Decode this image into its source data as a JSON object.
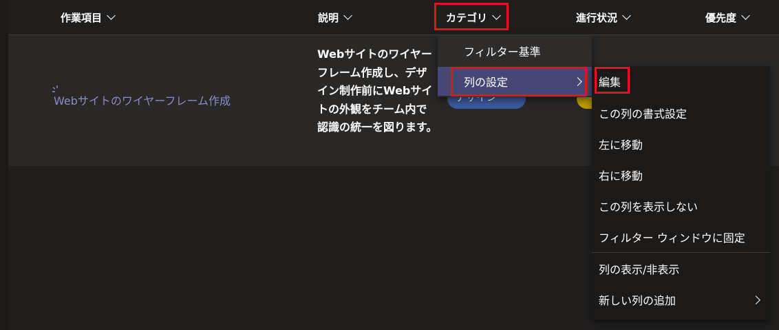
{
  "header": {
    "columns": [
      {
        "label": "作業項目"
      },
      {
        "label": "説明"
      },
      {
        "label": "カテゴリ"
      },
      {
        "label": "進行状況"
      },
      {
        "label": "優先度"
      }
    ]
  },
  "row": {
    "task_title": "Webサイトのワイヤーフレーム作成",
    "description": "Webサイトのワイヤーフレーム作成し、デザイン制作前にWebサイトの外観をチーム内で認識の統一を図ります。",
    "category_tag": "デザイン"
  },
  "column_menu": {
    "items": [
      {
        "label": "フィルター基準"
      },
      {
        "label": "列の設定"
      }
    ]
  },
  "column_settings_submenu": {
    "items": [
      {
        "label": "編集"
      },
      {
        "label": "この列の書式設定"
      },
      {
        "label": "左に移動"
      },
      {
        "label": "右に移動"
      },
      {
        "label": "この列を表示しない"
      },
      {
        "label": "フィルター ウィンドウに固定"
      },
      {
        "label": "列の表示/非表示"
      },
      {
        "label": "新しい列の追加"
      }
    ]
  },
  "colors": {
    "background": "#201f1e",
    "row_background": "#292827",
    "link": "#8b8cc7",
    "menu_active": "#464775",
    "highlight_box": "#e81123",
    "tag_blue": "#3a5a9c",
    "tag_yellow": "#c19c00"
  },
  "icons": [
    "chevron-down-icon",
    "chevron-right-icon",
    "sparkle-icon"
  ]
}
